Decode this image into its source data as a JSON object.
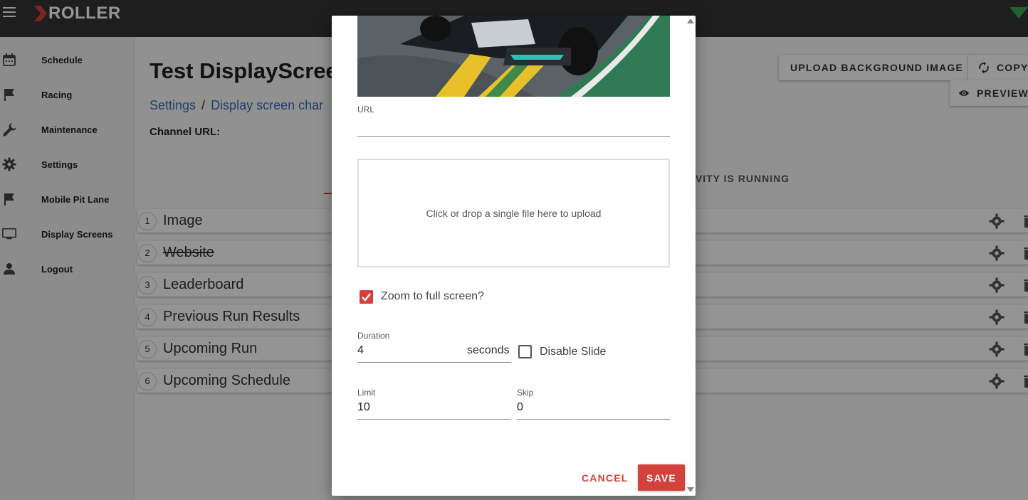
{
  "app": {
    "brand": "ROLLER",
    "colors": {
      "topbar": "#353535",
      "accent": "#d4403a",
      "link": "#3a6fbf",
      "wifi": "#3aa655"
    }
  },
  "sidebar": {
    "items": [
      {
        "label": "Schedule",
        "icon": "calendar-icon"
      },
      {
        "label": "Racing",
        "icon": "flag-icon"
      },
      {
        "label": "Maintenance",
        "icon": "wrench-icon"
      },
      {
        "label": "Settings",
        "icon": "gear-icon"
      },
      {
        "label": "Mobile Pit Lane",
        "icon": "flag-icon"
      },
      {
        "label": "Display Screens",
        "icon": "monitor-icon"
      },
      {
        "label": "Logout",
        "icon": "person-icon"
      }
    ]
  },
  "main": {
    "title": "Test DisplayScree",
    "breadcrumb": {
      "first": "Settings",
      "separator": "/",
      "second": "Display screen char"
    },
    "channel_url_label": "Channel URL:",
    "activity_text": "IVITY IS RUNNING",
    "buttons": {
      "upload_bg": "UPLOAD BACKGROUND IMAGE",
      "copy": "COPY",
      "preview": "PREVIEW"
    },
    "slides": [
      {
        "num": "1",
        "name": "Image",
        "disabled": false
      },
      {
        "num": "2",
        "name": "Website",
        "disabled": true
      },
      {
        "num": "3",
        "name": "Leaderboard",
        "disabled": false
      },
      {
        "num": "4",
        "name": "Previous Run Results",
        "disabled": false
      },
      {
        "num": "5",
        "name": "Upcoming Run",
        "disabled": false
      },
      {
        "num": "6",
        "name": "Upcoming Schedule",
        "disabled": false
      }
    ]
  },
  "dialog": {
    "url_label": "URL",
    "url_value": "",
    "dropzone_text": "Click or drop a single file here to upload",
    "zoom_label": "Zoom to full screen?",
    "zoom_checked": true,
    "duration_label": "Duration",
    "duration_value": "4",
    "duration_unit": "seconds",
    "disable_slide_label": "Disable Slide",
    "disable_slide_checked": false,
    "limit_label": "Limit",
    "limit_value": "10",
    "skip_label": "Skip",
    "skip_value": "0",
    "cancel_label": "CANCEL",
    "save_label": "SAVE"
  }
}
